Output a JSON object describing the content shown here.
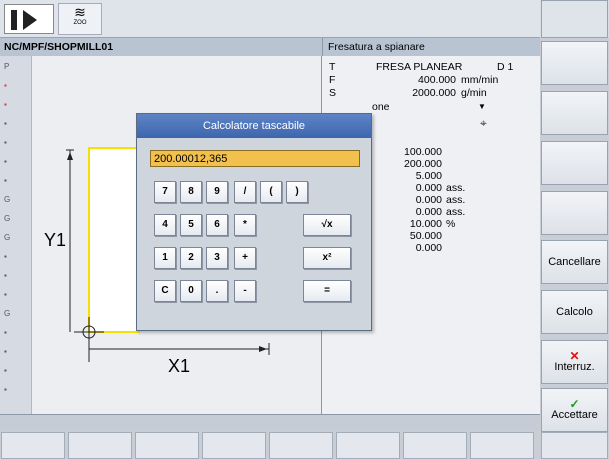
{
  "header": {
    "program_path": "NC/MPF/SHOPMILL01",
    "operation_title": "Fresatura a spianare",
    "op_icon_label": "ZOO"
  },
  "params": {
    "tool_letter": "T",
    "tool_name": "FRESA PLANEAR",
    "tool_d": "D 1",
    "feed_letter": "F",
    "feed_value": "400.000",
    "feed_unit": "mm/min",
    "speed_letter": "S",
    "speed_value": "2000.000",
    "speed_unit": "g/min",
    "row4_label": "one",
    "row4_symbol": "▼",
    "row5_symbol": "⌖",
    "values": [
      {
        "value": "100.000",
        "unit": ""
      },
      {
        "value": "200.000",
        "unit": ""
      },
      {
        "value": "5.000",
        "unit": ""
      },
      {
        "value": "0.000",
        "unit": "ass."
      },
      {
        "value": "0.000",
        "unit": "ass."
      },
      {
        "value": "0.000",
        "unit": "ass."
      },
      {
        "value": "10.000",
        "unit": "%"
      },
      {
        "value": "50.000",
        "unit": ""
      },
      {
        "value": "0.000",
        "unit": ""
      }
    ]
  },
  "graphics": {
    "y_label": "Y1",
    "x_label": "X1",
    "strip": [
      "P",
      "",
      "",
      "",
      "",
      "",
      "",
      "G",
      "G",
      "G",
      "",
      "",
      "",
      "G",
      "",
      "",
      "",
      ""
    ]
  },
  "calculator": {
    "title": "Calcolatore tascabile",
    "display": "200.00012,365",
    "keys": [
      [
        "7",
        "8",
        "9",
        "/",
        "(",
        ")"
      ],
      [
        "4",
        "5",
        "6",
        "*",
        "√x"
      ],
      [
        "1",
        "2",
        "3",
        "+",
        "x²"
      ],
      [
        "C",
        "0",
        ".",
        "-",
        "="
      ]
    ]
  },
  "vertical_softkeys": {
    "cancel": "Cancellare",
    "calculate": "Calcolo",
    "interrupt": "Interruz.",
    "accept": "Accettare"
  },
  "colors": {
    "title_bar": "#3e66ad",
    "display_bg": "#f2c04c",
    "contour": "#f5e000"
  }
}
